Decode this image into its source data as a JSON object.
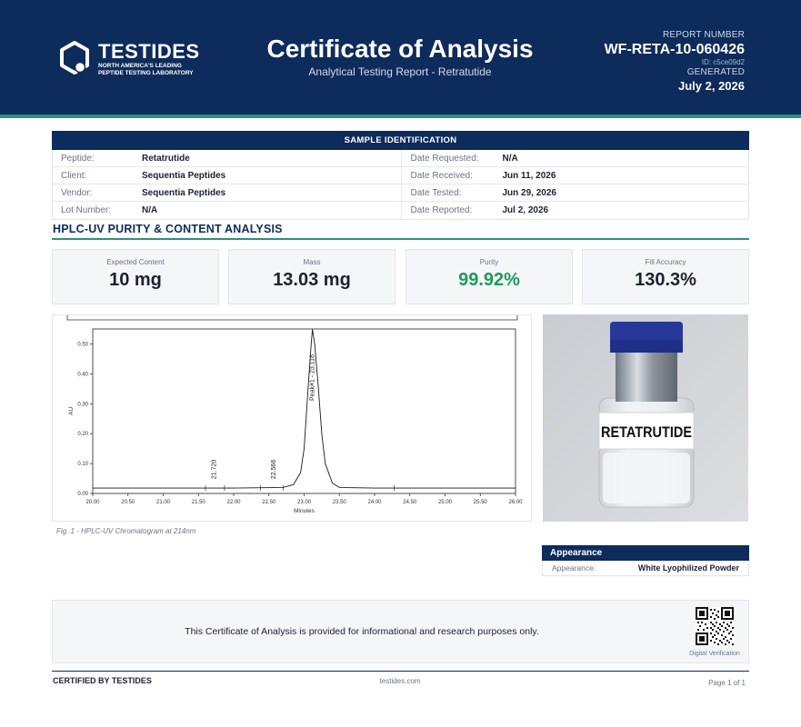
{
  "header": {
    "brand_name": "TESTIDES",
    "brand_tagline": "NORTH AMERICA'S LEADING\nPEPTIDE TESTING LABORATORY",
    "title": "Certificate of Analysis",
    "subtitle": "Analytical Testing Report  -  Retratutide",
    "report_number_label": "REPORT NUMBER",
    "report_number": "WF-RETA-10-060426",
    "report_id": "ID: c5ce09d2",
    "generated_label": "GENERATED",
    "generated_date": "July 2, 2026"
  },
  "sample_identification": {
    "heading": "SAMPLE IDENTIFICATION",
    "rows": [
      {
        "left_label": "Peptide:",
        "left_value": "Retatrutide",
        "right_label": "Date Requested:",
        "right_value": "N/A"
      },
      {
        "left_label": "Client:",
        "left_value": "Sequentia Peptides",
        "right_label": "Date Received:",
        "right_value": "Jun 11, 2026"
      },
      {
        "left_label": "Vendor:",
        "left_value": "Sequentia Peptides",
        "right_label": "Date Tested:",
        "right_value": "Jun 29, 2026"
      },
      {
        "left_label": "Lot Number:",
        "left_value": "N/A",
        "right_label": "Date Reported:",
        "right_value": "Jul 2, 2026"
      }
    ]
  },
  "analysis": {
    "section_title": "HPLC-UV PURITY & CONTENT ANALYSIS",
    "metrics": [
      {
        "label": "Expected Content",
        "value": "10 mg"
      },
      {
        "label": "Mass",
        "value": "13.03 mg"
      },
      {
        "label": "Purity",
        "value": "99.92%"
      },
      {
        "label": "Fill Accuracy",
        "value": "130.3%"
      }
    ],
    "figure_caption": "Fig. 1  -  HPLC-UV Chromatogram at 214nm"
  },
  "chart_data": {
    "type": "line",
    "xlabel": "Minutes",
    "ylabel": "AU",
    "xlim": [
      20.0,
      26.0
    ],
    "ylim": [
      0.0,
      0.55
    ],
    "x_ticks": [
      "20.00",
      "20.50",
      "21.00",
      "21.50",
      "22.00",
      "22.50",
      "23.00",
      "23.50",
      "24.00",
      "24.50",
      "25.00",
      "25.50",
      "26.00"
    ],
    "y_ticks": [
      "0.00",
      "0.10",
      "0.20",
      "0.30",
      "0.40",
      "0.50"
    ],
    "grid": false,
    "baseline": 0.018,
    "peaks": [
      {
        "label": "21.720",
        "x": 21.72,
        "height": 0.003
      },
      {
        "label": "22.566",
        "x": 22.566,
        "height": 0.004
      },
      {
        "label": "Peak#1 - 23.118",
        "x": 23.118,
        "height": 0.53
      }
    ],
    "integration_markers": [
      21.6,
      21.87,
      22.38,
      22.7,
      24.28
    ],
    "series": [
      {
        "x": [
          20.0,
          21.0,
          22.0,
          22.7,
          22.85,
          22.95,
          23.0,
          23.05,
          23.1,
          23.118,
          23.15,
          23.2,
          23.25,
          23.3,
          23.4,
          23.5,
          24.0,
          25.0,
          26.0
        ],
        "y": [
          0.018,
          0.018,
          0.018,
          0.02,
          0.03,
          0.07,
          0.15,
          0.33,
          0.5,
          0.548,
          0.5,
          0.36,
          0.2,
          0.1,
          0.035,
          0.02,
          0.018,
          0.018,
          0.018
        ]
      }
    ]
  },
  "photo": {
    "vial_label": "RETATRUTIDE"
  },
  "appearance": {
    "heading": "Appearance",
    "label": "Appearance:",
    "value": "White Lyophilized Powder"
  },
  "disclaimer": {
    "text": "This Certificate of Analysis is provided for informational and research purposes only.",
    "qr_label": "Digital Verification"
  },
  "footer": {
    "left": "CERTIFIED BY TESTIDES",
    "center": "testides.com",
    "right": "Page 1 of 1"
  },
  "colors": {
    "navy": "#0d2b5b",
    "teal": "#2f8f7f",
    "purity_green": "#1f9a5c"
  }
}
